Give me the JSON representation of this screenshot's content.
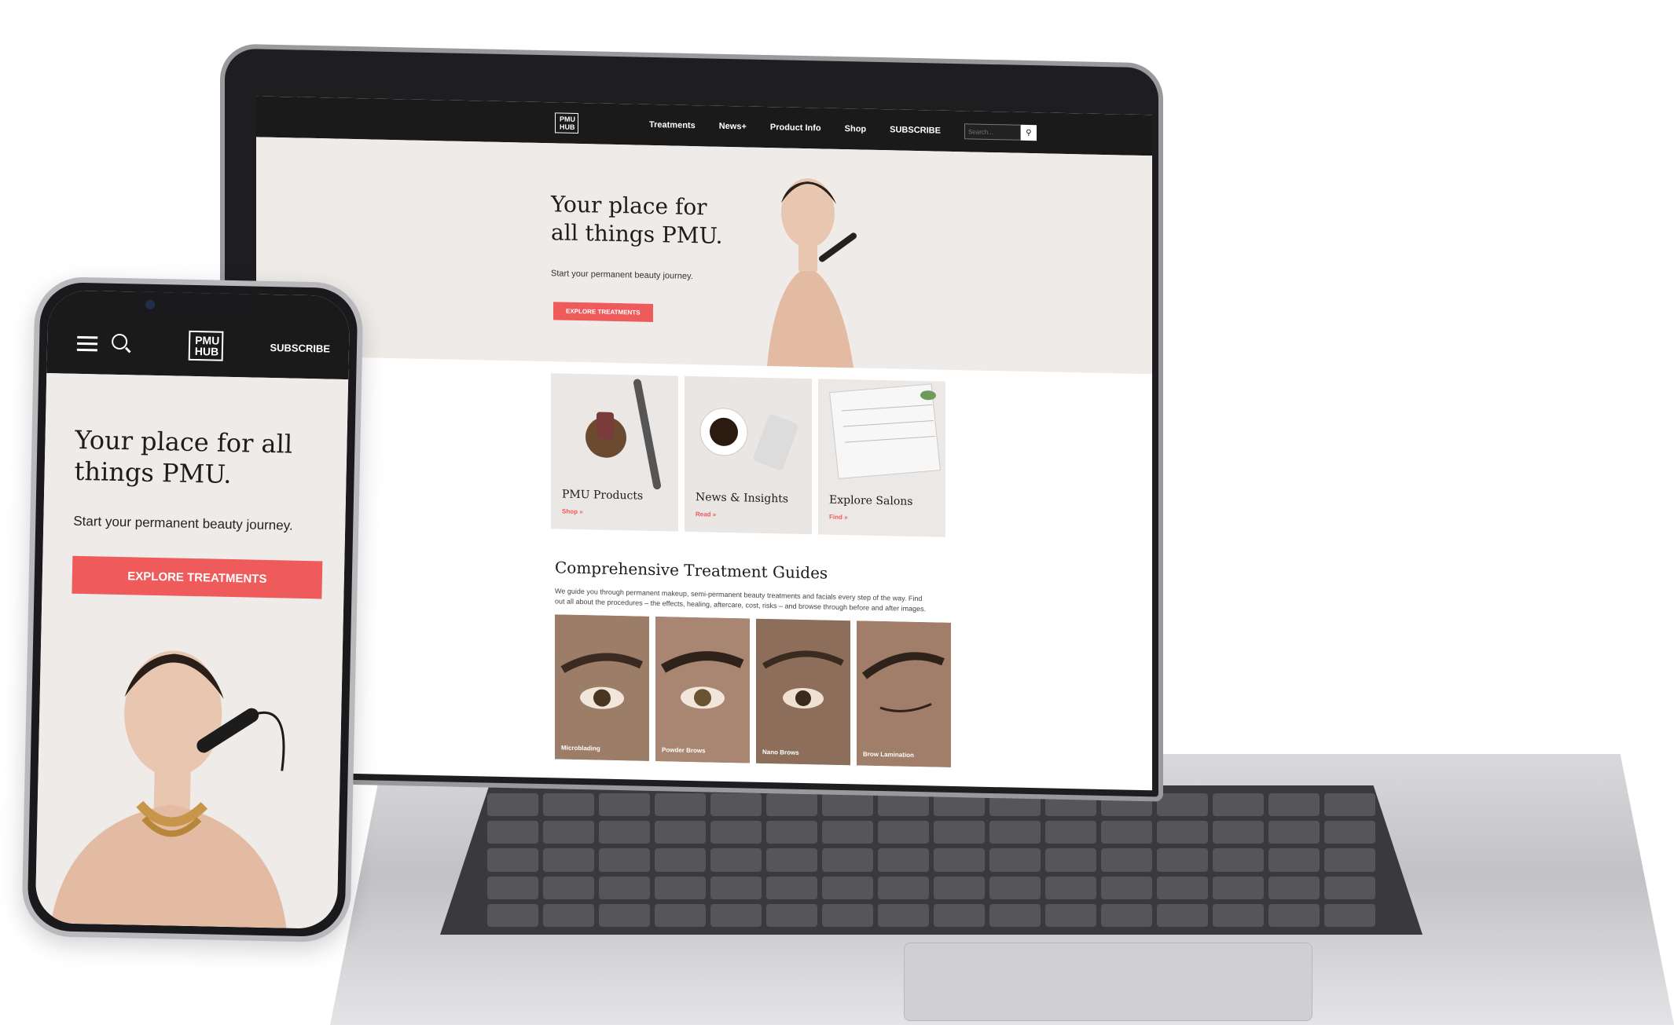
{
  "laptop": {
    "nav": {
      "logo_top": "PMU",
      "logo_bottom": "HUB",
      "links": [
        "Treatments",
        "News+",
        "Product Info",
        "Shop",
        "SUBSCRIBE"
      ],
      "search_placeholder": "Search...",
      "search_icon": "search-icon"
    },
    "hero": {
      "title": "Your place for all things PMU.",
      "subtitle": "Start your permanent beauty journey.",
      "cta_label": "EXPLORE TREATMENTS"
    },
    "cards": [
      {
        "title": "PMU Products",
        "link": "Shop »"
      },
      {
        "title": "News & Insights",
        "link": "Read »"
      },
      {
        "title": "Explore Salons",
        "link": "Find »"
      }
    ],
    "guides": {
      "title": "Comprehensive Treatment Guides",
      "description": "We guide you through permanent makeup, semi-permanent beauty treatments and facials every step of the way. Find out all about the procedures – the effects, healing, aftercare, cost, risks – and browse through before and after images.",
      "items": [
        "Microblading",
        "Powder Brows",
        "Nano Brows",
        "Brow Lamination"
      ]
    }
  },
  "phone": {
    "nav": {
      "logo_top": "PMU",
      "logo_bottom": "HUB",
      "subscribe_label": "SUBSCRIBE"
    },
    "hero": {
      "title": "Your place for all things PMU.",
      "subtitle": "Start your permanent beauty journey.",
      "cta_label": "EXPLORE TREATMENTS"
    }
  },
  "colors": {
    "accent": "#ef5a5a",
    "nav_bg": "#1a1a1a",
    "hero_bg": "#efebe8"
  }
}
